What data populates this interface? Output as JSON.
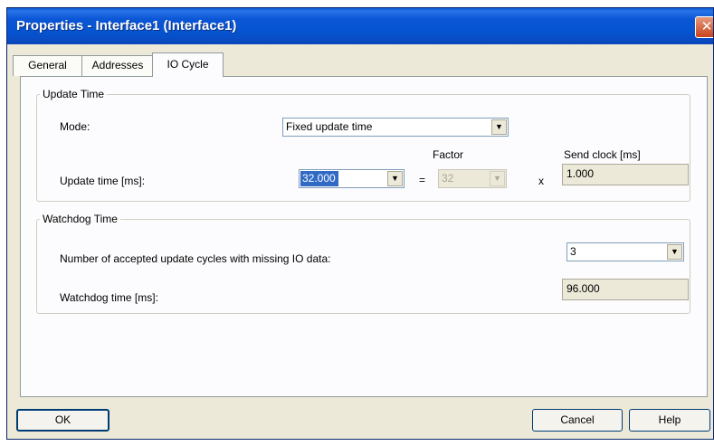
{
  "window": {
    "title": "Properties - Interface1 (Interface1)",
    "close_glyph": "✕"
  },
  "tabs": [
    {
      "label": "General",
      "selected": false
    },
    {
      "label": "Addresses",
      "selected": false
    },
    {
      "label": "IO Cycle",
      "selected": true
    }
  ],
  "update_time": {
    "legend": "Update Time",
    "mode_label": "Mode:",
    "mode_value": "Fixed update time",
    "factor_header": "Factor",
    "send_clock_header": "Send clock [ms]",
    "update_time_label": "Update time [ms]:",
    "update_time_value": "32.000",
    "equals": "=",
    "factor_value": "32",
    "times": "x",
    "send_clock_value": "1.000"
  },
  "watchdog": {
    "legend": "Watchdog Time",
    "cycles_label": "Number of accepted update cycles with missing IO data:",
    "cycles_value": "3",
    "time_label": "Watchdog time [ms]:",
    "time_value": "96.000"
  },
  "buttons": {
    "ok": "OK",
    "cancel": "Cancel",
    "help": "Help"
  },
  "icons": {
    "dropdown_arrow": "▼",
    "close": "close-icon"
  }
}
